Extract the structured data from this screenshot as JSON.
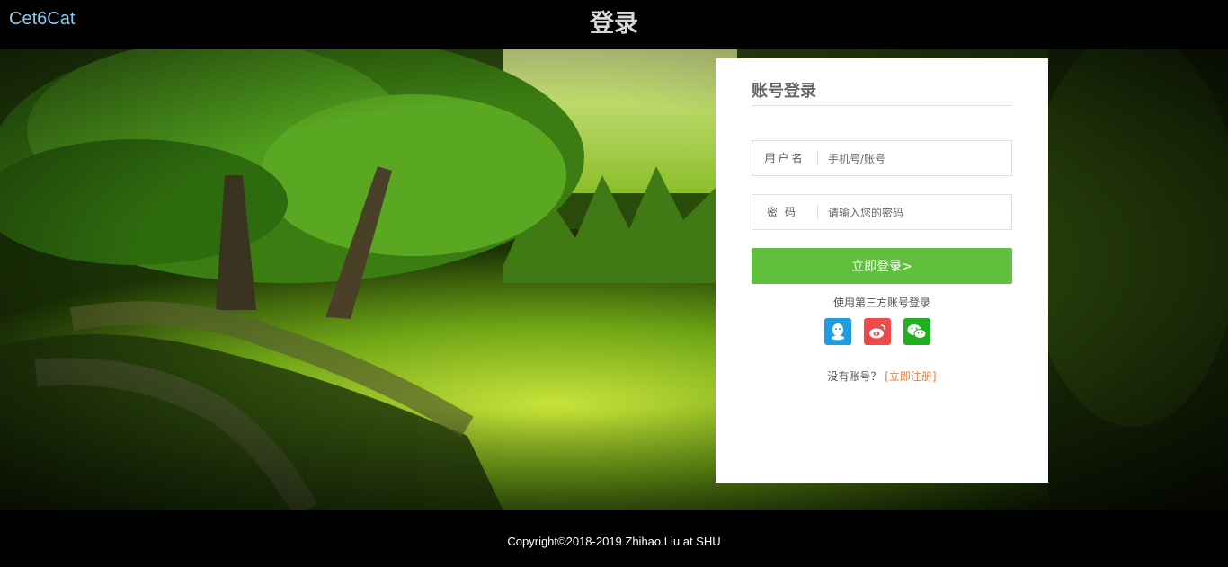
{
  "header": {
    "brand": "Cet6Cat",
    "title": "登录"
  },
  "login": {
    "heading": "账号登录",
    "username_label": "用户名",
    "username_placeholder": "手机号/账号",
    "password_label": "密码",
    "password_placeholder": "请输入您的密码",
    "submit_label": "立即登录>",
    "third_party_text": "使用第三方账号登录",
    "social": [
      {
        "icon": "qq-icon",
        "color": "#1e9ee0"
      },
      {
        "icon": "weibo-icon",
        "color": "#ef4a4a"
      },
      {
        "icon": "wechat-icon",
        "color": "#1fb01f"
      }
    ],
    "no_account_text": "没有账号？",
    "register_link": "[立即注册]"
  },
  "footer": {
    "copyright": "Copyright©2018-2019 Zhihao Liu at SHU"
  },
  "colors": {
    "accent": "#60c03e",
    "link": "#ee7c3c",
    "brand": "#8fc8f0"
  }
}
